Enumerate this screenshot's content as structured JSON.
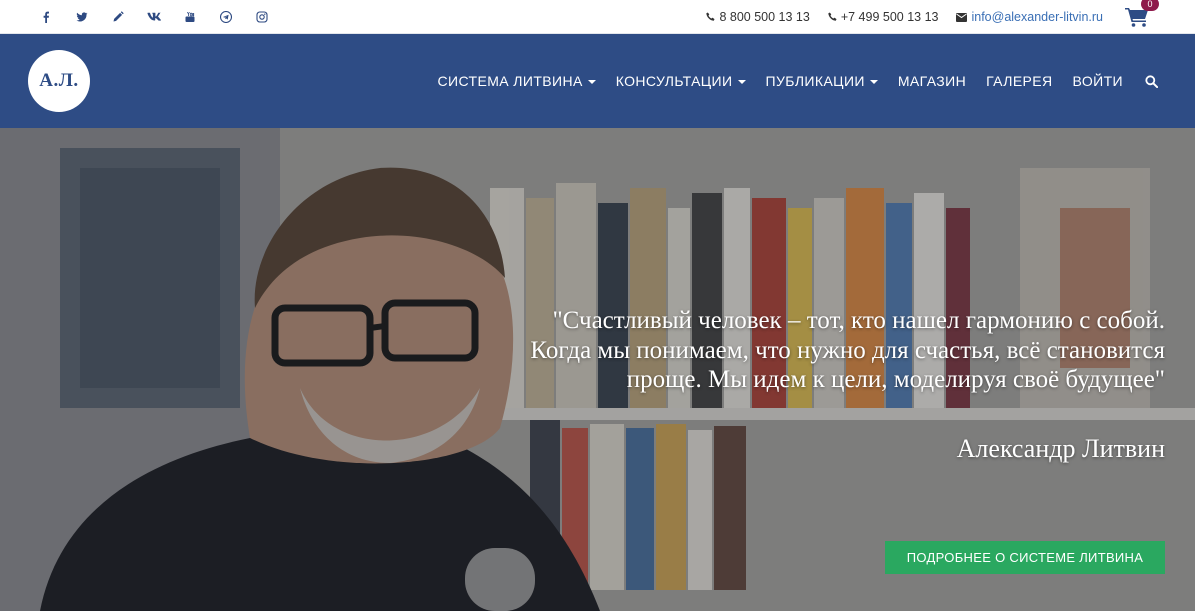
{
  "topbar": {
    "social": [
      {
        "name": "facebook-icon"
      },
      {
        "name": "twitter-icon"
      },
      {
        "name": "pencil-icon"
      },
      {
        "name": "vk-icon"
      },
      {
        "name": "youtube-icon"
      },
      {
        "name": "telegram-icon"
      },
      {
        "name": "instagram-icon"
      }
    ],
    "phone1": "8 800 500 13 13",
    "phone2": "+7 499 500 13 13",
    "email": "info@alexander-litvin.ru",
    "cart_count": "0"
  },
  "header": {
    "logo_text": "А.Л.",
    "nav": [
      {
        "label": "СИСТЕМА ЛИТВИНА",
        "dropdown": true
      },
      {
        "label": "КОНСУЛЬТАЦИИ",
        "dropdown": true
      },
      {
        "label": "ПУБЛИКАЦИИ",
        "dropdown": true
      },
      {
        "label": "МАГАЗИН",
        "dropdown": false
      },
      {
        "label": "ГАЛЕРЕЯ",
        "dropdown": false
      },
      {
        "label": "ВОЙТИ",
        "dropdown": false
      }
    ]
  },
  "hero": {
    "quote": "\"Счастливый человек – тот, кто нашел гармонию с собой. Когда мы понимаем, что нужно для счастья, всё становится проще. Мы идем к цели, моделируя своё будущее\"",
    "author": "Александр Литвин",
    "cta_label": "ПОДРОБНЕЕ О СИСТЕМЕ ЛИТВИНА"
  },
  "colors": {
    "header_bg": "#2e4c85",
    "cta_bg": "#2aa860",
    "badge_bg": "#8e1a4b",
    "link": "#3a6fb5"
  }
}
